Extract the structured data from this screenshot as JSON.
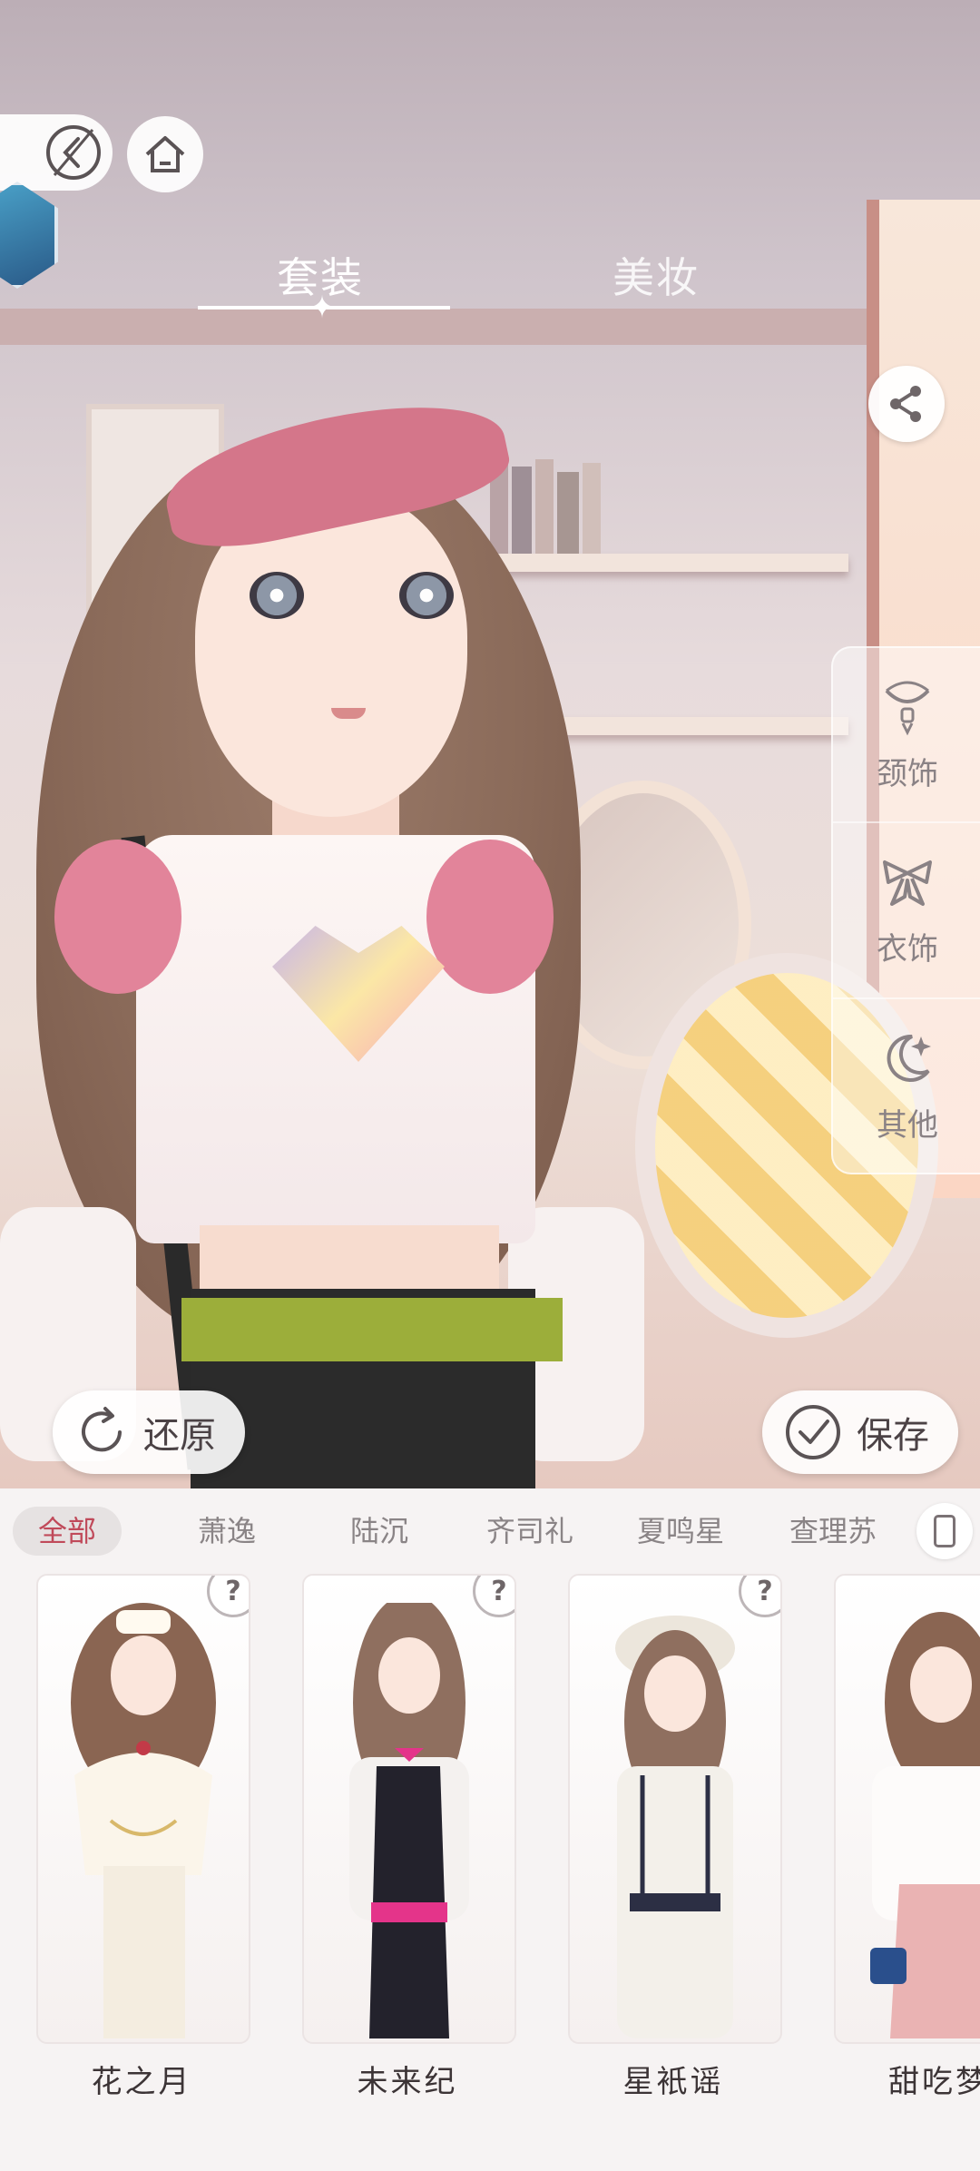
{
  "tabs": {
    "outfit": "套装",
    "makeup": "美妆"
  },
  "side_categories": [
    {
      "label": "颈饰",
      "icon": "necklace-icon"
    },
    {
      "label": "衣饰",
      "icon": "bow-icon"
    },
    {
      "label": "其他",
      "icon": "moon-sparkle-icon"
    }
  ],
  "actions": {
    "restore": "还原",
    "save": "保存"
  },
  "filters": [
    {
      "label": "全部",
      "active": true
    },
    {
      "label": "萧逸",
      "active": false
    },
    {
      "label": "陆沉",
      "active": false
    },
    {
      "label": "齐司礼",
      "active": false
    },
    {
      "label": "夏鸣星",
      "active": false
    },
    {
      "label": "查理苏",
      "active": false
    }
  ],
  "outfits": [
    {
      "name": "花之月",
      "unknown_badge": "?"
    },
    {
      "name": "未来纪",
      "unknown_badge": "?"
    },
    {
      "name": "星衹谣",
      "unknown_badge": "?"
    },
    {
      "name": "甜吃梦",
      "unknown_badge": ""
    }
  ],
  "colors": {
    "active_filter_text": "#c04a5a",
    "panel_bg": "#f6f3f3"
  }
}
